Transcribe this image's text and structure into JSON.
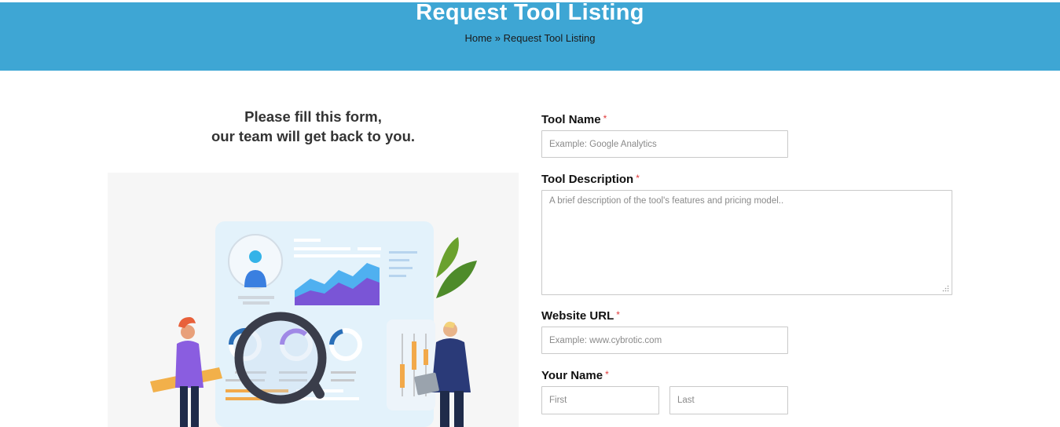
{
  "header": {
    "title": "Request Tool Listing",
    "breadcrumb": {
      "home": "Home",
      "separator": "»",
      "current": "Request Tool Listing"
    }
  },
  "intro": {
    "line1": "Please fill this form,",
    "line2": "our team will get back to you."
  },
  "form": {
    "required_mark": "*",
    "tool_name": {
      "label": "Tool Name",
      "placeholder": "Example: Google Analytics"
    },
    "tool_description": {
      "label": "Tool Description",
      "placeholder": "A brief description of the tool's features and pricing model.."
    },
    "website_url": {
      "label": "Website URL",
      "placeholder": "Example: www.cybrotic.com"
    },
    "your_name": {
      "label": "Your Name",
      "first_placeholder": "First",
      "last_placeholder": "Last"
    }
  },
  "colors": {
    "header_bg": "#3ea6d4",
    "required": "#e03a3a"
  }
}
